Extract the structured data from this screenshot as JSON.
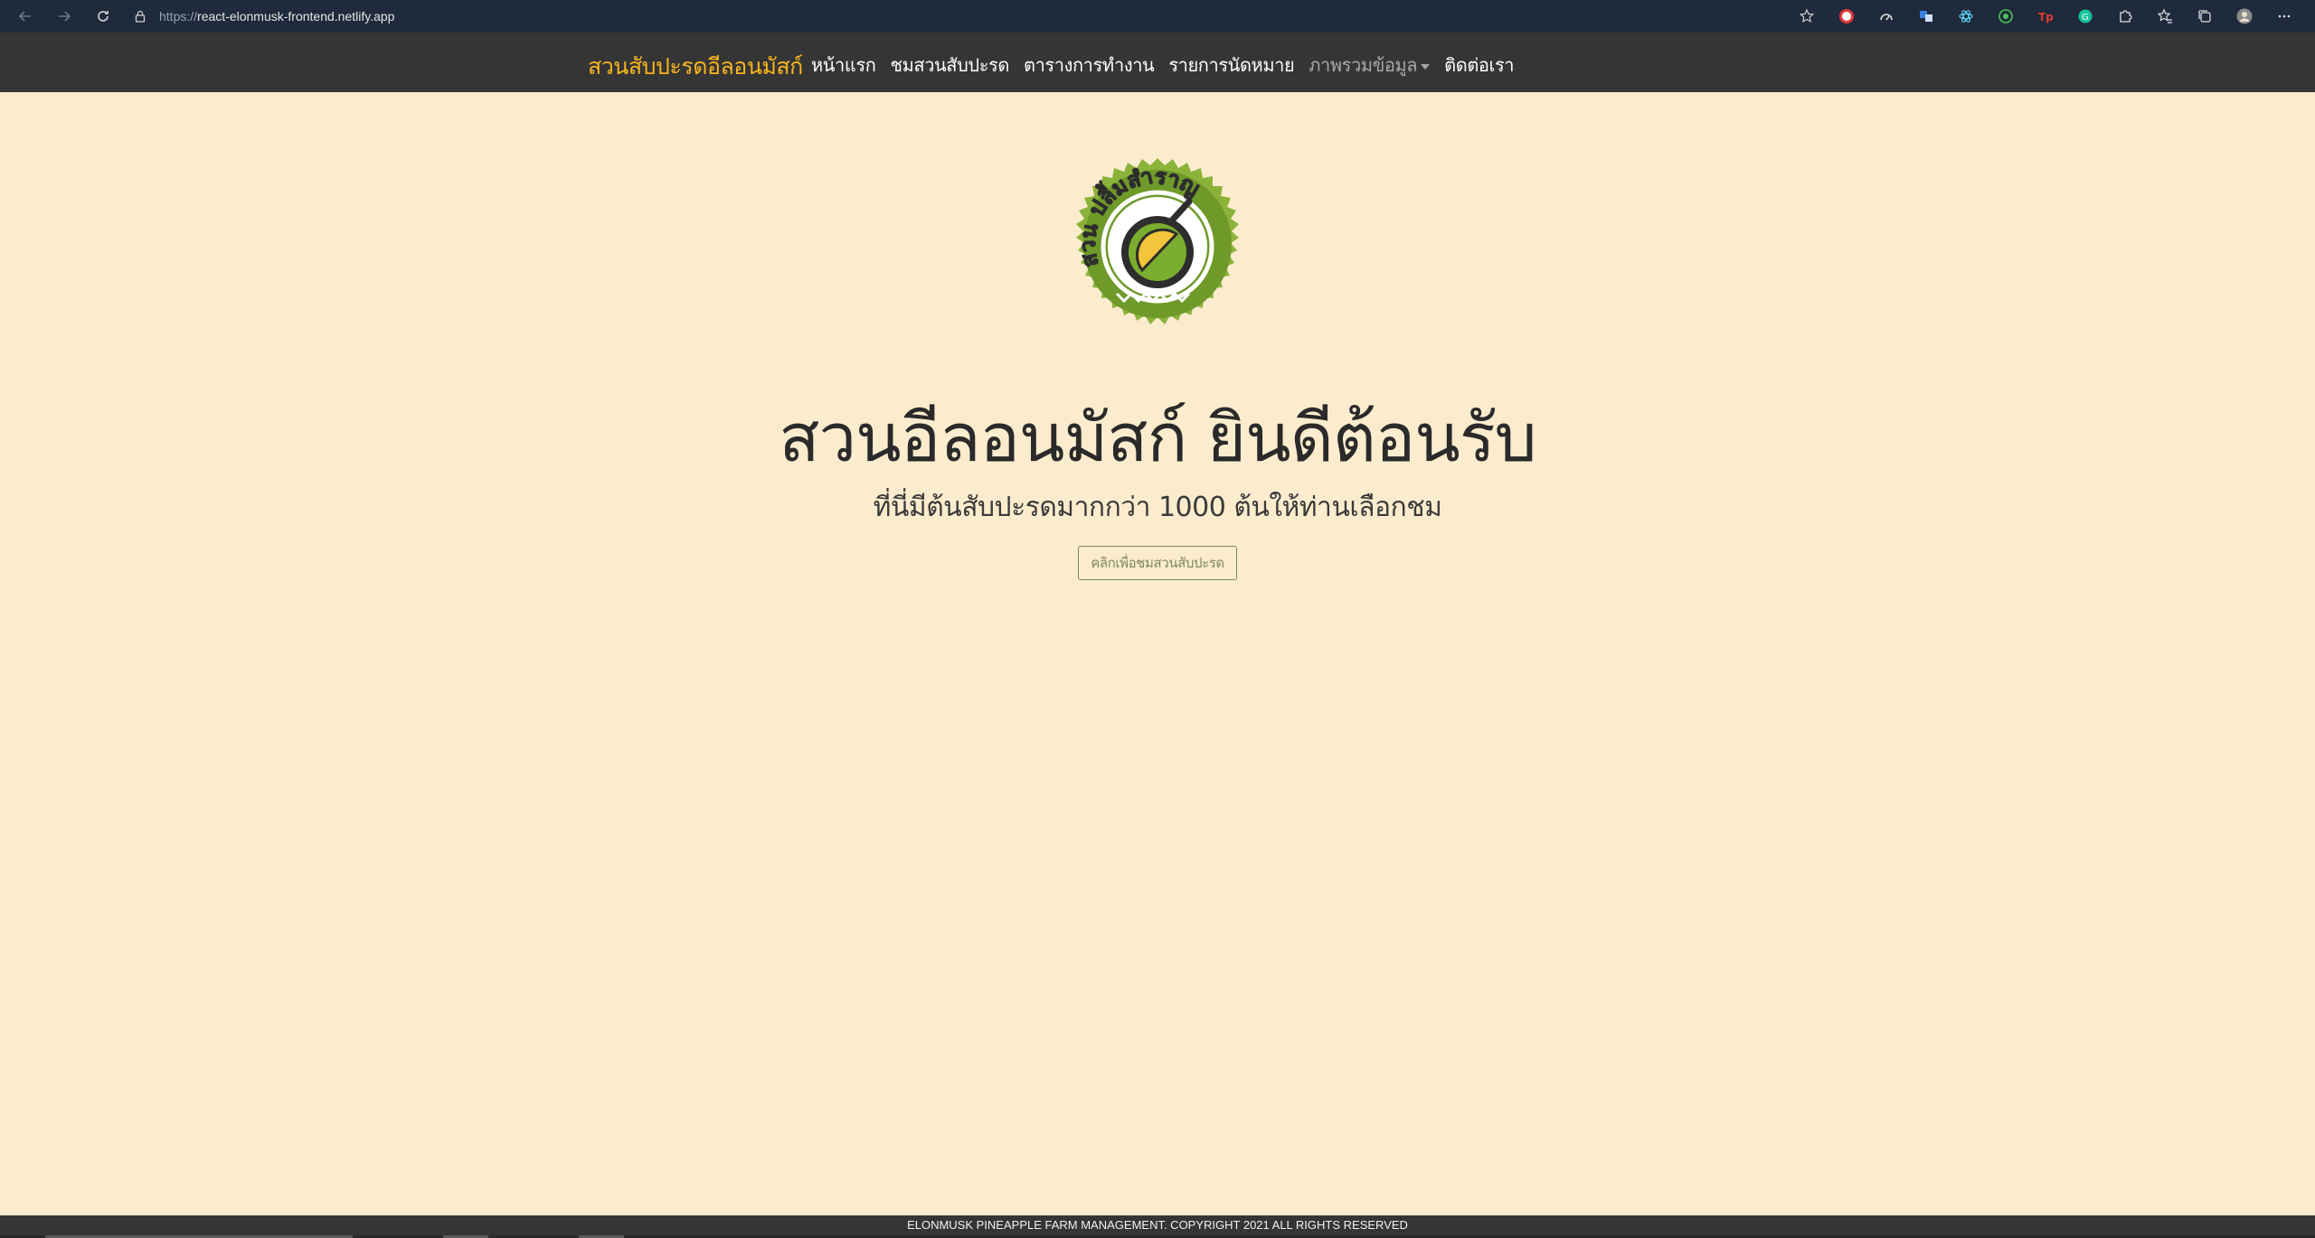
{
  "browser": {
    "url_scheme": "https://",
    "url_host": "react-elonmusk-frontend.netlify.app"
  },
  "navbar": {
    "brand": "สวนสับปะรดอีลอนมัสก์",
    "links": [
      {
        "label": "หน้าแรก"
      },
      {
        "label": "ชมสวนสับปะรด"
      },
      {
        "label": "ตารางการทำงาน"
      },
      {
        "label": "รายการนัดหมาย"
      },
      {
        "label": "ภาพรวมข้อมูล"
      },
      {
        "label": "ติดต่อเรา"
      }
    ]
  },
  "logo": {
    "text": "สวน ปลื้มสำราญ"
  },
  "hero": {
    "title": "สวนอีลอนมัสก์ ยินดีต้อนรับ",
    "subtitle": "ที่นี่มีต้นสับปะรดมากกว่า 1000 ต้นให้ท่านเลือกชม",
    "button": "คลิกเพื่อชมสวนสับปะรด"
  },
  "footer": {
    "text": "ELONMUSK PINEAPPLE FARM MANAGEMENT. COPYRIGHT 2021 ALL RIGHTS RESERVED"
  },
  "colors": {
    "page_bg": "#fcecce",
    "navbar_bg": "#353535",
    "brand": "#f7b51e",
    "logo_green": "#6f9a2a"
  }
}
